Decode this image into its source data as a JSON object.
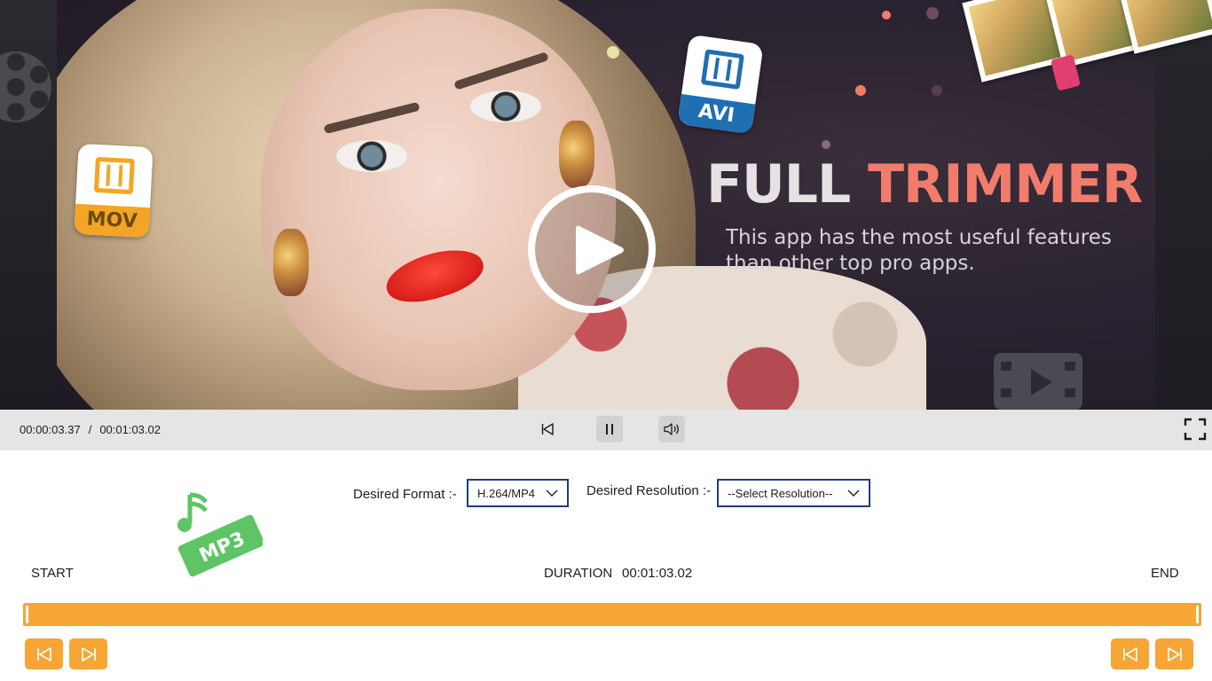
{
  "banner": {
    "headline_white": "FULL",
    "headline_accent": "TRIMMER",
    "subtitle": "This app has the most useful features than other top pro apps.",
    "mov_badge": "MOV",
    "avi_badge": "AVI",
    "mp3_badge": "MP3"
  },
  "player": {
    "current_time": "00:00:03.37",
    "separator": "/",
    "total_time": "00:01:03.02",
    "icons": {
      "play": "play-icon",
      "skip_back": "skip-back-icon",
      "pause": "pause-icon",
      "volume": "volume-icon",
      "fullscreen": "fullscreen-icon"
    }
  },
  "settings": {
    "format_label": "Desired Format :-",
    "format_value": "H.264/MP4",
    "resolution_label": "Desired Resolution :-",
    "resolution_value": "--Select Resolution--"
  },
  "timeline": {
    "start_label": "START",
    "duration_label": "DURATION",
    "duration_value": "00:01:03.02",
    "end_label": "END"
  },
  "colors": {
    "accent_orange": "#f7a534",
    "headline_accent": "#f27c6c",
    "select_border": "#1f3d7a",
    "control_bar": "#e6e5e5"
  }
}
